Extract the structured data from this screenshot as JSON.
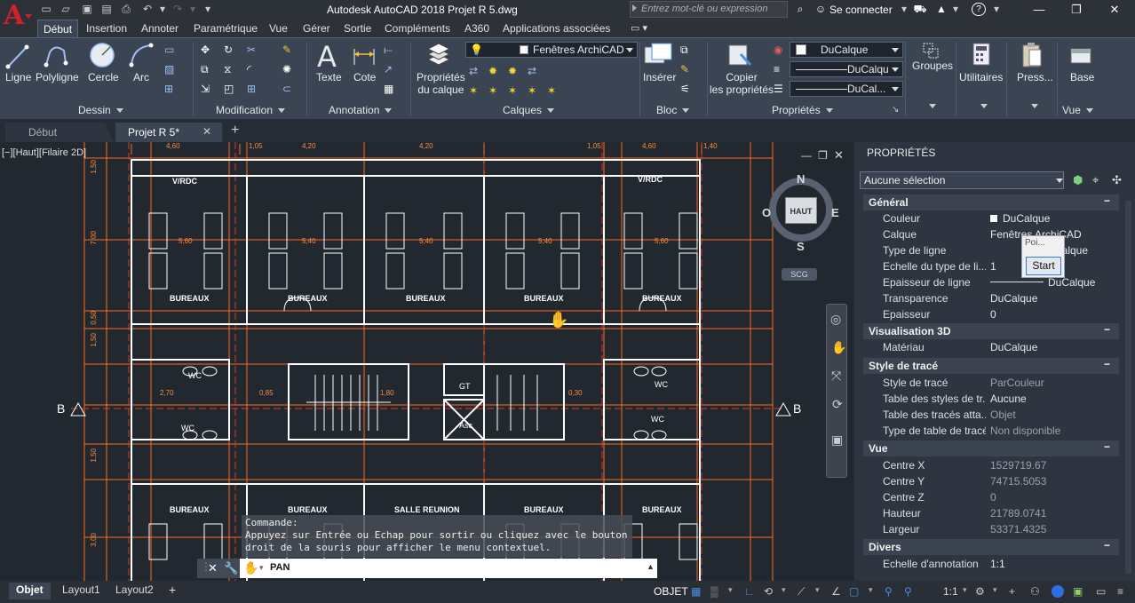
{
  "app": {
    "title": "Autodesk AutoCAD 2018   Projet R 5.dwg",
    "search_placeholder": "Entrez mot-clé ou expression",
    "sign_in": "Se connecter",
    "help_icon": "?"
  },
  "ribbon_tabs": [
    "Début",
    "Insertion",
    "Annoter",
    "Paramétrique",
    "Vue",
    "Gérer",
    "Sortie",
    "Compléments",
    "A360",
    "Applications associées"
  ],
  "ribbon": {
    "dessin": {
      "label": "Dessin",
      "buttons": [
        "Ligne",
        "Polyligne",
        "Cercle",
        "Arc"
      ]
    },
    "modification": {
      "label": "Modification"
    },
    "annotation": {
      "label": "Annotation",
      "buttons": [
        "Texte",
        "Cote"
      ]
    },
    "calques": {
      "label": "Calques",
      "props_btn_line1": "Propriétés",
      "props_btn_line2": "du calque",
      "layer_value": "Fenêtres ArchiCAD"
    },
    "bloc": {
      "label": "Bloc",
      "insert": "Insérer"
    },
    "proprietes": {
      "label": "Propriétés",
      "copy_line1": "Copier",
      "copy_line2": "les propriétés",
      "color_value": "DuCalque",
      "ltype_value": "DuCalqu",
      "lweight_value": "DuCal..."
    },
    "groupes": {
      "label": "Groupes"
    },
    "utilitaires": {
      "label": "Utilitaires"
    },
    "presse": {
      "label": "Press..."
    },
    "base": {
      "label": "Base"
    },
    "vue": {
      "label": "Vue"
    }
  },
  "doc_tabs": [
    "Début",
    "Projet R 5*"
  ],
  "viewport": {
    "label": "[−][Haut][Filaire 2D]",
    "viewcube": {
      "top": "HAUT",
      "n": "N",
      "s": "S",
      "e": "E",
      "o": "O",
      "scg": "SCG"
    },
    "plan_labels": {
      "vrdc": "V/RDC",
      "bureaux": "BUREAUX",
      "salle": "SALLE REUNION",
      "wc": "WC",
      "gt": "GT",
      "asc": "Asc",
      "section_b": "B"
    },
    "dims_top": [
      "4,60",
      "1,05",
      "4,20",
      "4,20",
      "1,05",
      "4,60",
      "1,40"
    ],
    "dims_room": [
      "5,60",
      "5,40",
      "5,40",
      "5,40",
      "5,60"
    ],
    "dims_side": [
      "1,50",
      "7,00",
      "0,50",
      "1,50",
      "2,70",
      "1,80",
      "0,85",
      "0,30",
      "1,50",
      "3,00"
    ]
  },
  "properties": {
    "title": "PROPRIÉTÉS",
    "selection": "Aucune sélection",
    "sections": [
      {
        "name": "Général",
        "rows": [
          {
            "k": "Couleur",
            "v": "DuCalque"
          },
          {
            "k": "Calque",
            "v": "Fenêtres ArchiCAD"
          },
          {
            "k": "Type de ligne",
            "v": "Calque"
          },
          {
            "k": "Echelle du type de li...",
            "v": "1"
          },
          {
            "k": "Epaisseur de ligne",
            "v": "DuCalque"
          },
          {
            "k": "Transparence",
            "v": "DuCalque"
          },
          {
            "k": "Epaisseur",
            "v": "0"
          }
        ]
      },
      {
        "name": "Visualisation 3D",
        "rows": [
          {
            "k": "Matériau",
            "v": "DuCalque"
          }
        ]
      },
      {
        "name": "Style de tracé",
        "rows": [
          {
            "k": "Style de tracé",
            "v": "ParCouleur"
          },
          {
            "k": "Table des styles de tr...",
            "v": "Aucune"
          },
          {
            "k": "Table des tracés atta...",
            "v": "Objet"
          },
          {
            "k": "Type de table de tracé",
            "v": "Non disponible"
          }
        ]
      },
      {
        "name": "Vue",
        "rows": [
          {
            "k": "Centre X",
            "v": "1529719.67"
          },
          {
            "k": "Centre Y",
            "v": "74715.5053"
          },
          {
            "k": "Centre Z",
            "v": "0"
          },
          {
            "k": "Hauteur",
            "v": "21789.0741"
          },
          {
            "k": "Largeur",
            "v": "53371.4325"
          }
        ]
      },
      {
        "name": "Divers",
        "rows": [
          {
            "k": "Echelle d'annotation",
            "v": "1:1"
          }
        ]
      }
    ],
    "popup_text": "Poi...",
    "popup_button": "Start"
  },
  "command": {
    "history_label": "Commande:",
    "history_line1": "Appuyez sur Entrée ou Echap pour sortir ou cliquez avec le bouton",
    "history_line2": "droit de la souris pour afficher le menu contextuel.",
    "current": "PAN"
  },
  "status": {
    "layout_tabs": [
      "Objet",
      "Layout1",
      "Layout2"
    ],
    "model": "OBJET",
    "scale": "1:1"
  },
  "colors": {
    "accent": "#4a8fe0",
    "plan_lines": "#ffffff",
    "dim_lines": "#ff6a1f",
    "grid_axis": "#d83a1e",
    "autocad_red": "#d4202a"
  }
}
